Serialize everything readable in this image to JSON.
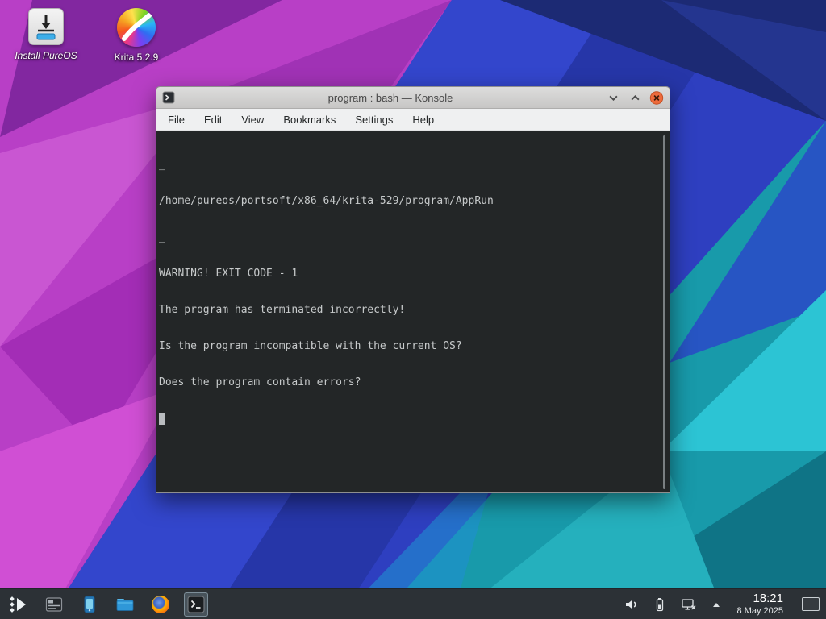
{
  "desktop": {
    "icons": [
      {
        "label": "Install PureOS",
        "icon": "install-pureos-icon"
      },
      {
        "label": "Krita 5.2.9",
        "icon": "krita-icon"
      }
    ]
  },
  "window": {
    "title": "program : bash — Konsole",
    "menu": [
      "File",
      "Edit",
      "View",
      "Bookmarks",
      "Settings",
      "Help"
    ],
    "terminal_lines": [
      "_",
      "/home/pureos/portsoft/x86_64/krita-529/program/AppRun",
      "_",
      "WARNING! EXIT CODE - 1",
      "The program has terminated incorrectly!",
      "Is the program incompatible with the current OS?",
      "Does the program contain errors?"
    ]
  },
  "taskbar": {
    "clock": {
      "time": "18:21",
      "date": "8 May 2025"
    }
  },
  "icons": {
    "window_buttons": [
      "chevron-down-icon",
      "chevron-up-icon",
      "close-icon"
    ],
    "tray": [
      "volume-icon",
      "battery-icon",
      "display-indicator-icon",
      "chevron-up-icon"
    ],
    "launcher": "app-launcher-icon",
    "show_desktop": "show-desktop-icon"
  },
  "colors": {
    "terminal_bg": "#232627",
    "taskbar_bg": "#2c3136",
    "close_button": "#ed6b3c",
    "wallpaper_magenta": "#b83fc6",
    "wallpaper_blue": "#3346cc",
    "wallpaper_teal": "#189aaa"
  }
}
